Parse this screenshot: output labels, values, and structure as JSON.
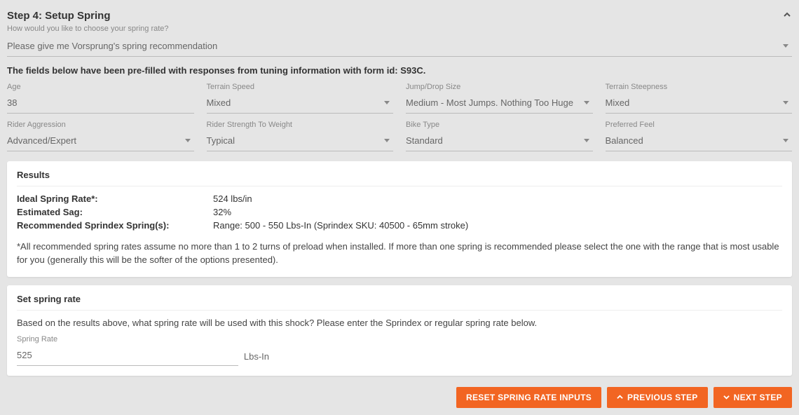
{
  "header": {
    "title": "Step 4: Setup Spring",
    "subtext": "How would you like to choose your spring rate?"
  },
  "rate_method": {
    "label": "",
    "value": "Please give me Vorsprung's spring recommendation"
  },
  "prefill_line": "The fields below have been pre-filled with responses from tuning information with form id: S93C.",
  "fields": {
    "age": {
      "label": "Age",
      "value": "38"
    },
    "terrain_speed": {
      "label": "Terrain Speed",
      "value": "Mixed"
    },
    "jump_drop_size": {
      "label": "Jump/Drop Size",
      "value": "Medium - Most Jumps. Nothing Too Huge"
    },
    "terrain_steepness": {
      "label": "Terrain Steepness",
      "value": "Mixed"
    },
    "rider_aggression": {
      "label": "Rider Aggression",
      "value": "Advanced/Expert"
    },
    "rider_strength": {
      "label": "Rider Strength To Weight",
      "value": "Typical"
    },
    "bike_type": {
      "label": "Bike Type",
      "value": "Standard"
    },
    "preferred_feel": {
      "label": "Preferred Feel",
      "value": "Balanced"
    }
  },
  "results": {
    "title": "Results",
    "ideal_label": "Ideal Spring Rate*:",
    "ideal_value": "524 lbs/in",
    "sag_label": "Estimated Sag:",
    "sag_value": "32%",
    "rec_label": "Recommended Sprindex Spring(s):",
    "rec_value": "Range: 500 - 550 Lbs-In (Sprindex SKU: 40500 - 65mm stroke)",
    "note": "*All recommended spring rates assume no more than 1 to 2 turns of preload when installed. If more than one spring is recommended please select the one with the range that is most usable for you (generally this will be the softer of the options presented)."
  },
  "set_spring": {
    "title": "Set spring rate",
    "desc": "Based on the results above, what spring rate will be used with this shock? Please enter the Sprindex or regular spring rate below.",
    "field_label": "Spring Rate",
    "value": "525",
    "unit": "Lbs-In"
  },
  "buttons": {
    "reset": "RESET SPRING RATE INPUTS",
    "previous": "PREVIOUS STEP",
    "next": "NEXT STEP"
  }
}
